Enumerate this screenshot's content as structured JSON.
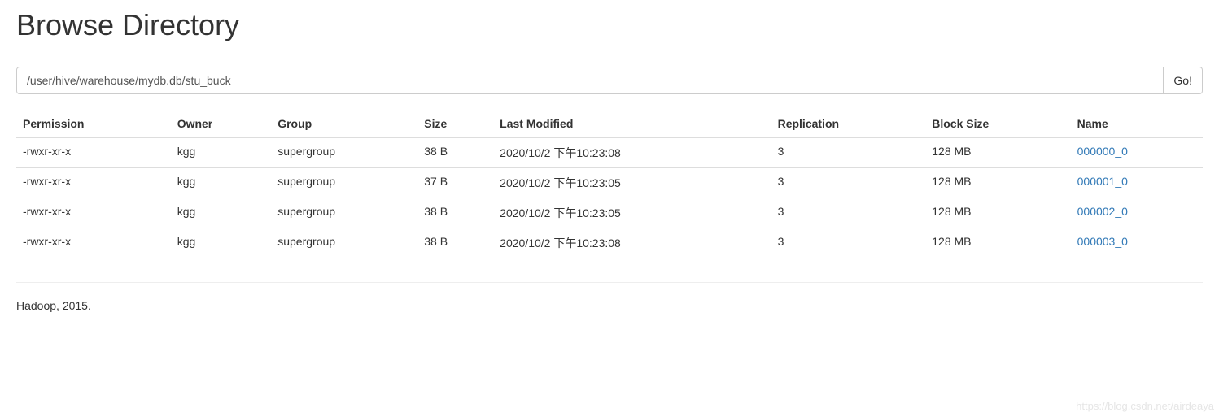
{
  "header": {
    "title": "Browse Directory"
  },
  "path": {
    "value": "/user/hive/warehouse/mydb.db/stu_buck",
    "go_label": "Go!"
  },
  "table": {
    "headers": {
      "permission": "Permission",
      "owner": "Owner",
      "group": "Group",
      "size": "Size",
      "last_modified": "Last Modified",
      "replication": "Replication",
      "block_size": "Block Size",
      "name": "Name"
    },
    "rows": [
      {
        "permission": "-rwxr-xr-x",
        "owner": "kgg",
        "group": "supergroup",
        "size": "38 B",
        "last_modified": "2020/10/2 下午10:23:08",
        "replication": "3",
        "block_size": "128 MB",
        "name": "000000_0"
      },
      {
        "permission": "-rwxr-xr-x",
        "owner": "kgg",
        "group": "supergroup",
        "size": "37 B",
        "last_modified": "2020/10/2 下午10:23:05",
        "replication": "3",
        "block_size": "128 MB",
        "name": "000001_0"
      },
      {
        "permission": "-rwxr-xr-x",
        "owner": "kgg",
        "group": "supergroup",
        "size": "38 B",
        "last_modified": "2020/10/2 下午10:23:05",
        "replication": "3",
        "block_size": "128 MB",
        "name": "000002_0"
      },
      {
        "permission": "-rwxr-xr-x",
        "owner": "kgg",
        "group": "supergroup",
        "size": "38 B",
        "last_modified": "2020/10/2 下午10:23:08",
        "replication": "3",
        "block_size": "128 MB",
        "name": "000003_0"
      }
    ]
  },
  "footer": {
    "text": "Hadoop, 2015."
  },
  "watermark": {
    "text": "https://blog.csdn.net/airdeaya"
  }
}
